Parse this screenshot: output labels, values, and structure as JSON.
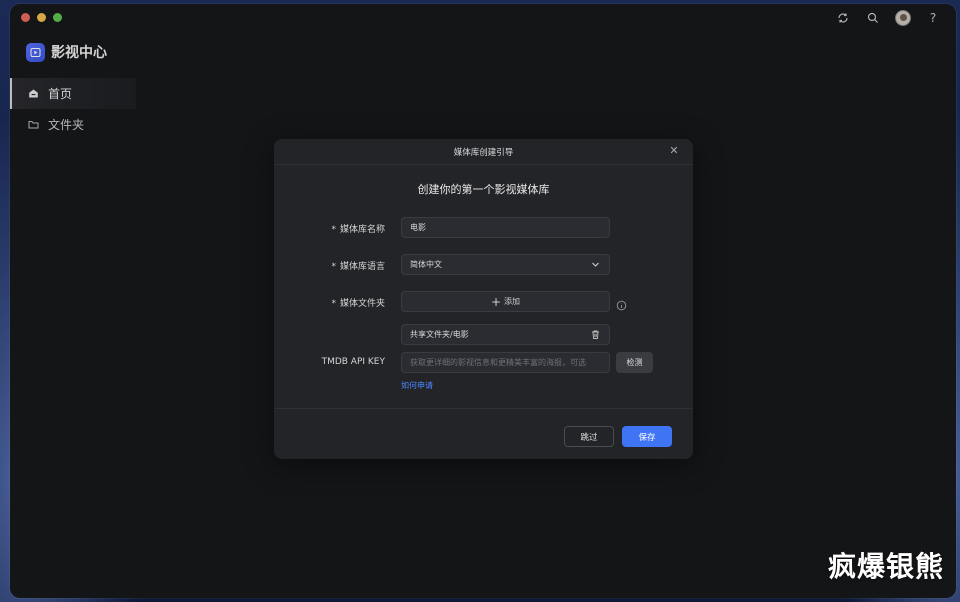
{
  "app": {
    "title": "影视中心"
  },
  "sidebar": {
    "items": [
      {
        "label": "首页",
        "icon": "home-icon",
        "active": true
      },
      {
        "label": "文件夹",
        "icon": "folder-icon",
        "active": false
      }
    ]
  },
  "toolbar": {
    "icons": [
      "refresh-icon",
      "search-icon",
      "avatar",
      "help-icon"
    ],
    "help_label": "?"
  },
  "modal": {
    "title": "媒体库创建引导",
    "heading": "创建你的第一个影视媒体库",
    "required_mark": "*",
    "fields": {
      "name": {
        "label": "媒体库名称",
        "value": "电影"
      },
      "language": {
        "label": "媒体库语言",
        "value": "简体中文"
      },
      "folder": {
        "label": "媒体文件夹",
        "add_label": "添加",
        "path": "共享文件夹/电影"
      },
      "tmdb": {
        "label": "TMDB API KEY",
        "placeholder": "获取更详细的影视信息和更精美丰富的海报，可选",
        "check_label": "检测",
        "help_link": "如何申请"
      }
    },
    "buttons": {
      "skip": "跳过",
      "save": "保存"
    }
  },
  "watermark": "疯爆银熊",
  "colors": {
    "accent": "#3f74f4",
    "link": "#4c86ff",
    "window_bg": "#17181b",
    "modal_bg": "#232428"
  }
}
